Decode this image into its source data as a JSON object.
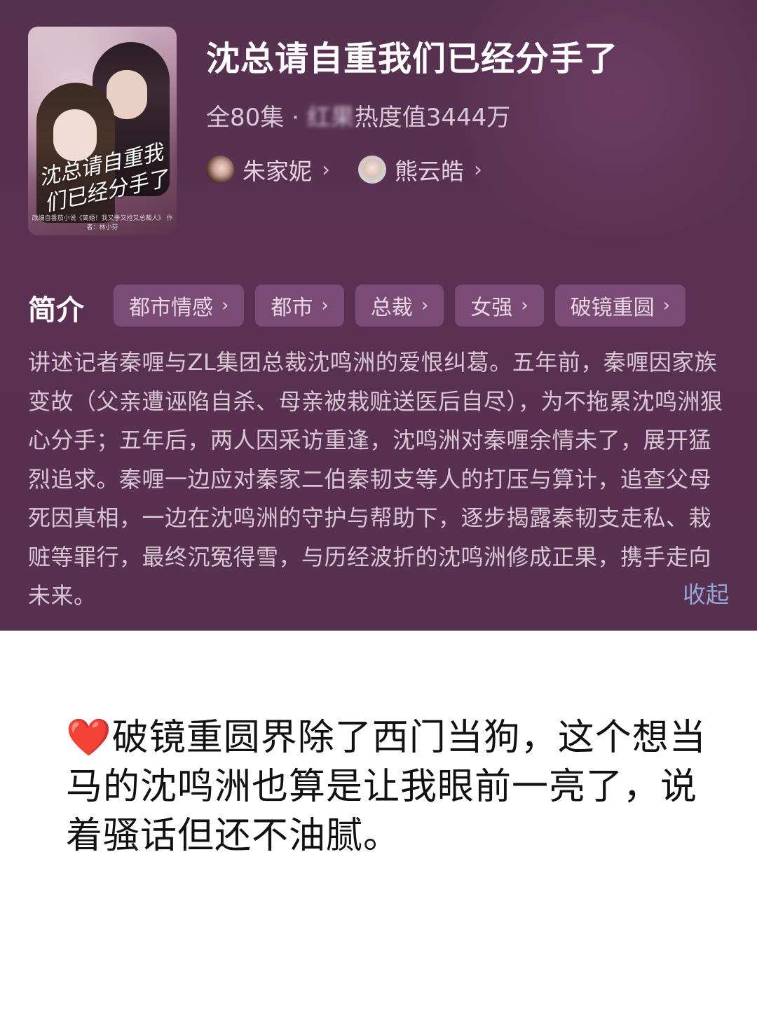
{
  "drama": {
    "title": "沈总请自重我们已经分手了",
    "episodes": "全80集",
    "separator": " · ",
    "platform_obscured": "红果",
    "popularity": "热度值3444万",
    "actors": [
      {
        "name": "朱家妮",
        "chevron": "›"
      },
      {
        "name": "熊云皓",
        "chevron": "›"
      }
    ],
    "poster": {
      "title_text": "沈总请自重我们已经分手了",
      "credit": "改编自番茄小说《离婚！我又争又抢又总裁人》 作者：林小芬"
    }
  },
  "intro": {
    "label": "简介",
    "tags": [
      {
        "label": "都市情感",
        "chevron": "›"
      },
      {
        "label": "都市",
        "chevron": "›"
      },
      {
        "label": "总裁",
        "chevron": "›"
      },
      {
        "label": "女强",
        "chevron": "›"
      },
      {
        "label": "破镜重圆",
        "chevron": "›"
      }
    ],
    "description": "讲述记者秦喱与ZL集团总裁沈鸣洲的爱恨纠葛。五年前，秦喱因家族变故（父亲遭诬陷自杀、母亲被栽赃送医后自尽），为不拖累沈鸣洲狠心分手；五年后，两人因采访重逢，沈鸣洲对秦喱余情未了，展开猛烈追求。秦喱一边应对秦家二伯秦韧支等人的打压与算计，追查父母死因真相，一边在沈鸣洲的守护与帮助下，逐步揭露秦韧支走私、栽赃等罪行，最终沉冤得雪，与历经波折的沈鸣洲修成正果，携手走向未来。",
    "collapse_label": "收起"
  },
  "comment": {
    "heart": "❤️",
    "text": "破镜重圆界除了西门当狗，这个想当马的沈鸣洲也算是让我眼前一亮了，说着骚话但还不油腻。"
  },
  "colors": {
    "panel_bg": "#583050",
    "tag_bg": "#7a4b75",
    "collapse_link": "#93a8d4",
    "comment_text": "#111111"
  }
}
